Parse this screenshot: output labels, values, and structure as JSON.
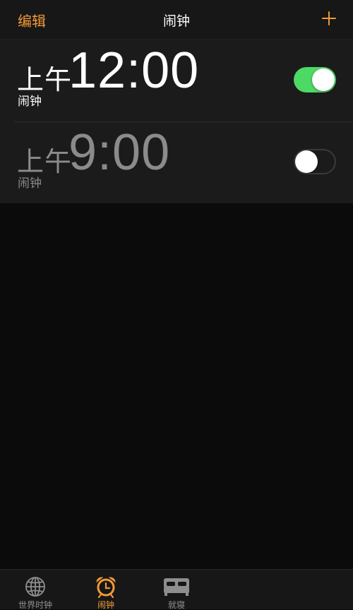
{
  "navbar": {
    "edit_label": "编辑",
    "title": "闹钟",
    "add_icon": "plus-icon"
  },
  "alarms": [
    {
      "period": "上午",
      "time": "12:00",
      "label": "闹钟",
      "enabled": true
    },
    {
      "period": "上午",
      "time": "9:00",
      "label": "闹钟",
      "enabled": false
    }
  ],
  "tabbar": {
    "tabs": [
      {
        "label": "世界时钟",
        "icon": "globe-icon",
        "active": false
      },
      {
        "label": "闹钟",
        "icon": "alarm-clock-icon",
        "active": true
      },
      {
        "label": "就寝",
        "icon": "bed-icon",
        "active": false
      }
    ]
  },
  "colors": {
    "accent": "#f19a38",
    "toggle_on": "#4cd964",
    "background": "#0b0b0b",
    "list_background": "#1b1b1b",
    "inactive_text": "#8b8b8b"
  }
}
